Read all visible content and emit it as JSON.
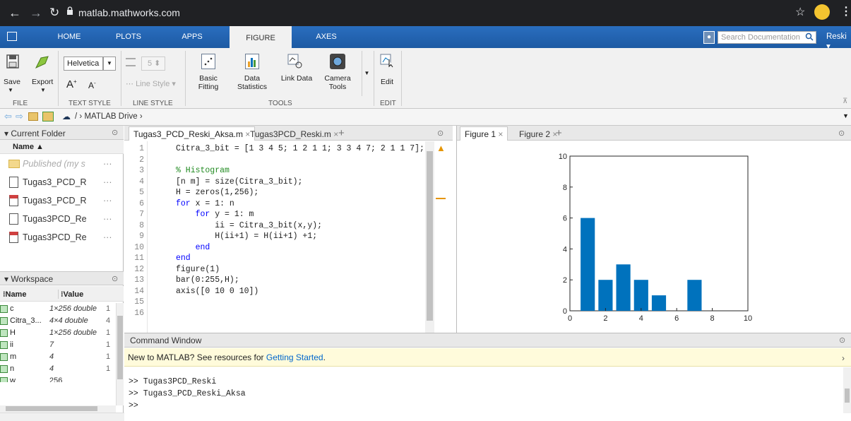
{
  "browser": {
    "url": "matlab.mathworks.com",
    "user": "Reski"
  },
  "ribbon_tabs": [
    "HOME",
    "PLOTS",
    "APPS",
    "FIGURE",
    "AXES"
  ],
  "search_placeholder": "Search Documentation",
  "ribbon": {
    "file": {
      "save": "Save",
      "export": "Export",
      "label": "FILE"
    },
    "text_style": {
      "font": "Helvetica",
      "label": "TEXT STYLE"
    },
    "line_style": {
      "width": "5",
      "style": "Line Style",
      "label": "LINE STYLE"
    },
    "tools": {
      "basic_fitting_1": "Basic",
      "basic_fitting_2": "Fitting",
      "data_stats_1": "Data",
      "data_stats_2": "Statistics",
      "link_data": "Link Data",
      "camera_1": "Camera",
      "camera_2": "Tools",
      "label": "TOOLS"
    },
    "edit": {
      "edit": "Edit",
      "label": "EDIT"
    }
  },
  "address": {
    "path": "MATLAB Drive",
    "sep": "/ ›",
    "sep2": "›"
  },
  "current_folder": {
    "title": "Current Folder",
    "name_header": "Name ▲",
    "items": [
      "Published (my s",
      "Tugas3_PCD_R",
      "Tugas3_PCD_R",
      "Tugas3PCD_Re",
      "Tugas3PCD_Re"
    ]
  },
  "workspace": {
    "title": "Workspace",
    "col_name": "Name",
    "col_value": "Value",
    "rows": [
      {
        "name": "c",
        "value": "1×256 double",
        "extra": "1"
      },
      {
        "name": "Citra_3...",
        "value": "4×4 double",
        "extra": "4"
      },
      {
        "name": "H",
        "value": "1×256 double",
        "extra": "1"
      },
      {
        "name": "ii",
        "value": "7",
        "extra": "1"
      },
      {
        "name": "m",
        "value": "4",
        "extra": "1"
      },
      {
        "name": "n",
        "value": "4",
        "extra": "1"
      },
      {
        "name": "w",
        "value": "256",
        "extra": ""
      }
    ]
  },
  "editor": {
    "tabs": [
      "Tugas3_PCD_Reski_Aksa.m",
      "Tugas3PCD_Reski.m"
    ],
    "lines": [
      {
        "n": "1",
        "html": "<span>Citra_3_bit = [1 3 4 5; 1 2 1 1; 3 3 4 7; 2 1 1 7];</span>"
      },
      {
        "n": "2",
        "html": ""
      },
      {
        "n": "3",
        "html": "<span class='cm'>% Histogram</span>"
      },
      {
        "n": "4",
        "html": "<span>[n m] = size(Citra_3_bit);</span>"
      },
      {
        "n": "5",
        "html": "<span>H = zeros(1,256);</span>"
      },
      {
        "n": "6",
        "html": "<span class='kw'>for</span><span> x = 1: n</span>"
      },
      {
        "n": "7",
        "html": "<span>    </span><span class='kw'>for</span><span> y = 1: m</span>"
      },
      {
        "n": "8",
        "html": "<span>        ii = Citra_3_bit(x,y);</span>"
      },
      {
        "n": "9",
        "html": "<span>        H(ii+1) = H(ii+1) +1;</span>"
      },
      {
        "n": "10",
        "html": "<span>    </span><span class='kw'>end</span>"
      },
      {
        "n": "11",
        "html": "<span class='kw'>end</span>"
      },
      {
        "n": "12",
        "html": "<span>figure(1)</span>"
      },
      {
        "n": "13",
        "html": "<span>bar(0:255,H);</span>"
      },
      {
        "n": "14",
        "html": "<span>axis([0 10 0 10])</span>"
      },
      {
        "n": "15",
        "html": ""
      },
      {
        "n": "16",
        "html": ""
      }
    ]
  },
  "figure": {
    "tabs": [
      "Figure 1",
      "Figure 2"
    ]
  },
  "chart_data": {
    "type": "bar",
    "x": [
      0,
      1,
      2,
      3,
      4,
      5,
      6,
      7,
      8,
      9,
      10
    ],
    "values": [
      0,
      6,
      2,
      3,
      2,
      1,
      0,
      2,
      0,
      0,
      0
    ],
    "xlim": [
      0,
      10
    ],
    "ylim": [
      0,
      10
    ],
    "xticks": [
      "0",
      "2",
      "4",
      "6",
      "8",
      "10"
    ],
    "yticks": [
      "0",
      "2",
      "4",
      "6",
      "8",
      "10"
    ],
    "color": "#0072BD"
  },
  "command_window": {
    "title": "Command Window",
    "notice_prefix": "New to MATLAB? See resources for ",
    "notice_link": "Getting Started",
    "notice_suffix": ".",
    "lines": [
      ">> Tugas3PCD_Reski",
      ">> Tugas3_PCD_Reski_Aksa",
      ">>"
    ]
  }
}
